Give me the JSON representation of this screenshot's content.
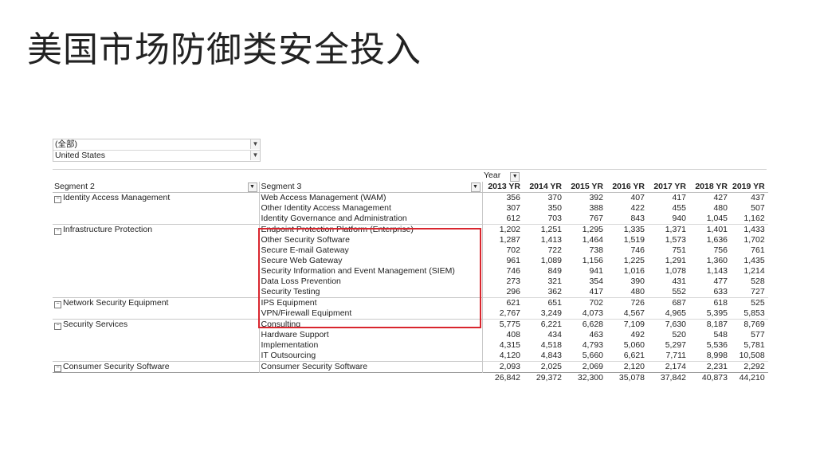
{
  "title": "美国市场防御类安全投入",
  "filter": {
    "all_label": "(全部)",
    "country": "United States"
  },
  "pivot": {
    "year_label": "Year",
    "segment2_header": "Segment 2",
    "segment3_header": "Segment 3",
    "years": [
      "2013 YR",
      "2014 YR",
      "2015 YR",
      "2016 YR",
      "2017 YR",
      "2018 YR",
      "2019 YR"
    ],
    "groups": [
      {
        "name": "Identity Access Management",
        "rows": [
          {
            "name": "Web Access Management (WAM)",
            "values": [
              "356",
              "370",
              "392",
              "407",
              "417",
              "427",
              "437"
            ]
          },
          {
            "name": "Other Identity Access Management",
            "values": [
              "307",
              "350",
              "388",
              "422",
              "455",
              "480",
              "507"
            ]
          },
          {
            "name": "Identity Governance and Administration",
            "values": [
              "612",
              "703",
              "767",
              "843",
              "940",
              "1,045",
              "1,162"
            ]
          }
        ]
      },
      {
        "name": "Infrastructure Protection",
        "rows": [
          {
            "name": "Endpoint Protection Platform (Enterprise)",
            "values": [
              "1,202",
              "1,251",
              "1,295",
              "1,335",
              "1,371",
              "1,401",
              "1,433"
            ]
          },
          {
            "name": "Other Security Software",
            "values": [
              "1,287",
              "1,413",
              "1,464",
              "1,519",
              "1,573",
              "1,636",
              "1,702"
            ]
          },
          {
            "name": "Secure E-mail Gateway",
            "values": [
              "702",
              "722",
              "738",
              "746",
              "751",
              "756",
              "761"
            ]
          },
          {
            "name": "Secure Web Gateway",
            "values": [
              "961",
              "1,089",
              "1,156",
              "1,225",
              "1,291",
              "1,360",
              "1,435"
            ]
          },
          {
            "name": "Security Information and Event Management (SIEM)",
            "values": [
              "746",
              "849",
              "941",
              "1,016",
              "1,078",
              "1,143",
              "1,214"
            ]
          },
          {
            "name": "Data Loss Prevention",
            "values": [
              "273",
              "321",
              "354",
              "390",
              "431",
              "477",
              "528"
            ]
          },
          {
            "name": "Security Testing",
            "values": [
              "296",
              "362",
              "417",
              "480",
              "552",
              "633",
              "727"
            ]
          }
        ]
      },
      {
        "name": "Network Security Equipment",
        "rows": [
          {
            "name": "IPS Equipment",
            "values": [
              "621",
              "651",
              "702",
              "726",
              "687",
              "618",
              "525"
            ]
          },
          {
            "name": "VPN/Firewall Equipment",
            "values": [
              "2,767",
              "3,249",
              "4,073",
              "4,567",
              "4,965",
              "5,395",
              "5,853"
            ]
          }
        ]
      },
      {
        "name": "Security Services",
        "rows": [
          {
            "name": "Consulting",
            "values": [
              "5,775",
              "6,221",
              "6,628",
              "7,109",
              "7,630",
              "8,187",
              "8,769"
            ]
          },
          {
            "name": "Hardware Support",
            "values": [
              "408",
              "434",
              "463",
              "492",
              "520",
              "548",
              "577"
            ]
          },
          {
            "name": "Implementation",
            "values": [
              "4,315",
              "4,518",
              "4,793",
              "5,060",
              "5,297",
              "5,536",
              "5,781"
            ]
          },
          {
            "name": "IT Outsourcing",
            "values": [
              "4,120",
              "4,843",
              "5,660",
              "6,621",
              "7,711",
              "8,998",
              "10,508"
            ]
          }
        ]
      },
      {
        "name": "Consumer Security Software",
        "rows": [
          {
            "name": "Consumer Security Software",
            "values": [
              "2,093",
              "2,025",
              "2,069",
              "2,120",
              "2,174",
              "2,231",
              "2,292"
            ]
          }
        ]
      }
    ],
    "totals": [
      "26,842",
      "29,372",
      "32,300",
      "35,078",
      "37,842",
      "40,873",
      "44,210"
    ]
  }
}
